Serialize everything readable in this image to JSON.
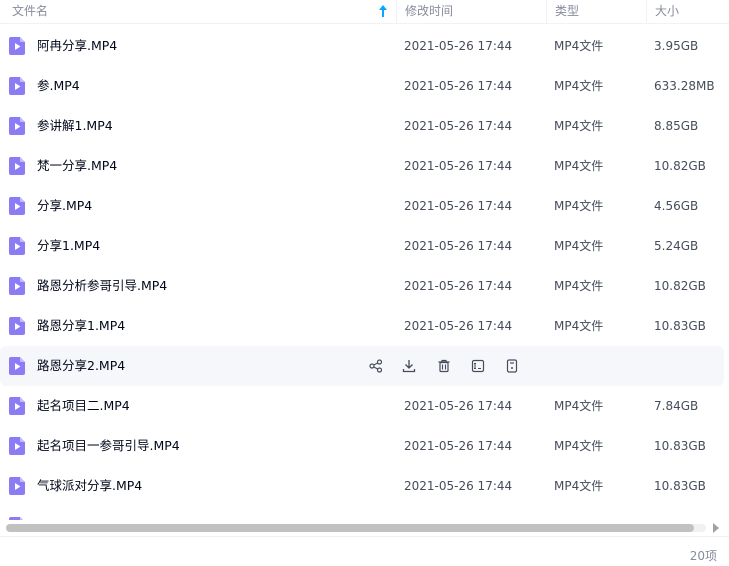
{
  "header": {
    "name_label": "文件名",
    "time_label": "修改时间",
    "type_label": "类型",
    "size_label": "大小",
    "sort_icon": "sort-up-arrow-icon"
  },
  "colors": {
    "accent": "#06a7ff",
    "file_icon": "#8b7cf6"
  },
  "files": [
    {
      "name": "阿冉分享.MP4",
      "time": "2021-05-26 17:44",
      "type": "MP4文件",
      "size": "3.95GB"
    },
    {
      "name": "参.MP4",
      "time": "2021-05-26 17:44",
      "type": "MP4文件",
      "size": "633.28MB"
    },
    {
      "name": "参讲解1.MP4",
      "time": "2021-05-26 17:44",
      "type": "MP4文件",
      "size": "8.85GB"
    },
    {
      "name": "梵一分享.MP4",
      "time": "2021-05-26 17:44",
      "type": "MP4文件",
      "size": "10.82GB"
    },
    {
      "name": "分享.MP4",
      "time": "2021-05-26 17:44",
      "type": "MP4文件",
      "size": "4.56GB"
    },
    {
      "name": "分享1.MP4",
      "time": "2021-05-26 17:44",
      "type": "MP4文件",
      "size": "5.24GB"
    },
    {
      "name": "路恩分析参哥引导.MP4",
      "time": "2021-05-26 17:44",
      "type": "MP4文件",
      "size": "10.82GB"
    },
    {
      "name": "路恩分享1.MP4",
      "time": "2021-05-26 17:44",
      "type": "MP4文件",
      "size": "10.83GB"
    },
    {
      "name": "路恩分享2.MP4",
      "time": "",
      "type": "",
      "size": ""
    },
    {
      "name": "起名项目二.MP4",
      "time": "2021-05-26 17:44",
      "type": "MP4文件",
      "size": "7.84GB"
    },
    {
      "name": "起名项目一参哥引导.MP4",
      "time": "2021-05-26 17:44",
      "type": "MP4文件",
      "size": "10.83GB"
    },
    {
      "name": "气球派对分享.MP4",
      "time": "2021-05-26 17:44",
      "type": "MP4文件",
      "size": "10.83GB"
    }
  ],
  "hover_actions": [
    "share-icon",
    "download-icon",
    "delete-icon",
    "rename-icon",
    "more-icon"
  ],
  "footer": {
    "count": "20项"
  }
}
